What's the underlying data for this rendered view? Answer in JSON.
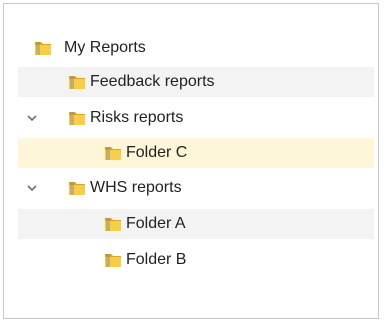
{
  "tree": {
    "root": {
      "label": "My Reports",
      "icon": "folder-icon"
    },
    "items": [
      {
        "label": "Feedback reports",
        "icon": "folder-icon"
      },
      {
        "label": "Risks reports",
        "icon": "folder-icon",
        "expanded": true
      },
      {
        "label": "Folder C",
        "icon": "folder-icon",
        "selected": true
      },
      {
        "label": "WHS reports",
        "icon": "folder-icon",
        "expanded": true
      },
      {
        "label": "Folder A",
        "icon": "folder-icon"
      },
      {
        "label": "Folder B",
        "icon": "folder-icon"
      }
    ]
  },
  "colors": {
    "folder_body": "#f2b632",
    "folder_front": "#f7cd4a",
    "selected_row": "#fdf6d8",
    "hover_row": "#f3f3f3",
    "chevron": "#6d6d6d"
  }
}
